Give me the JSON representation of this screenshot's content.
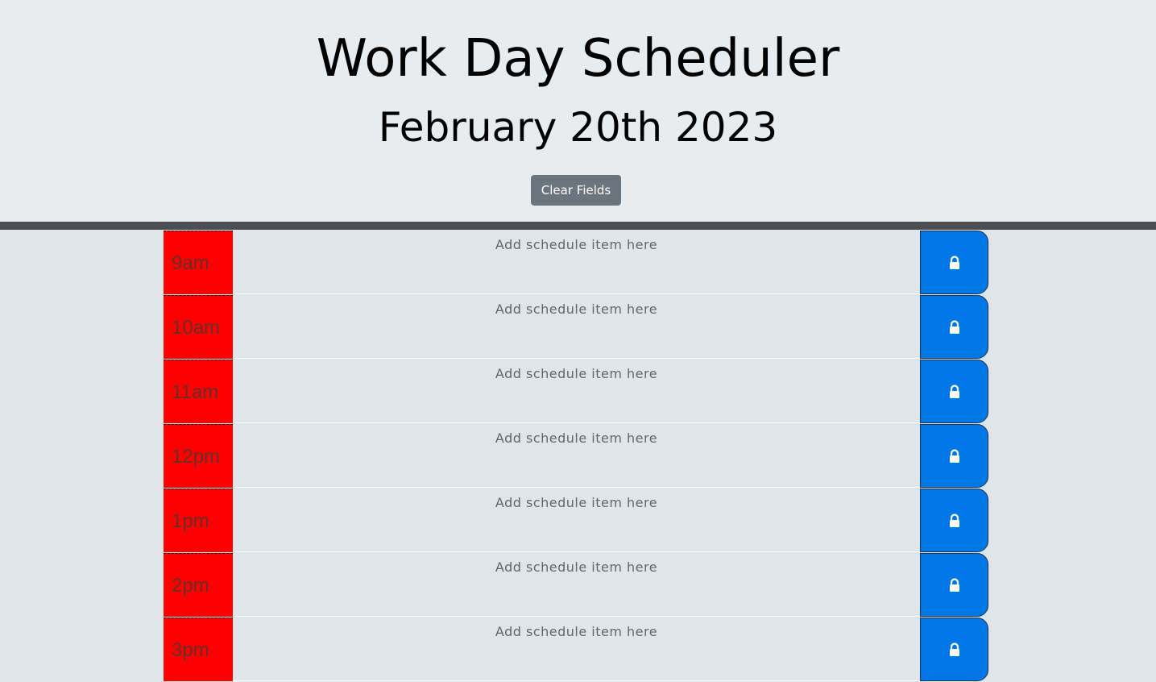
{
  "header": {
    "title": "Work Day Scheduler",
    "date": "February 20th 2023",
    "clear_button": "Clear Fields"
  },
  "schedule": {
    "placeholder": "Add schedule item here",
    "hours": [
      {
        "label": "9am",
        "value": ""
      },
      {
        "label": "10am",
        "value": ""
      },
      {
        "label": "11am",
        "value": ""
      },
      {
        "label": "12pm",
        "value": ""
      },
      {
        "label": "1pm",
        "value": ""
      },
      {
        "label": "2pm",
        "value": ""
      },
      {
        "label": "3pm",
        "value": ""
      }
    ],
    "save_icon": "lock-icon"
  },
  "colors": {
    "past": "#ff0000",
    "save_button": "#0077e6",
    "clear_button": "#6c757d",
    "header_bg": "#e9ecef",
    "divider": "#4b4f54"
  }
}
